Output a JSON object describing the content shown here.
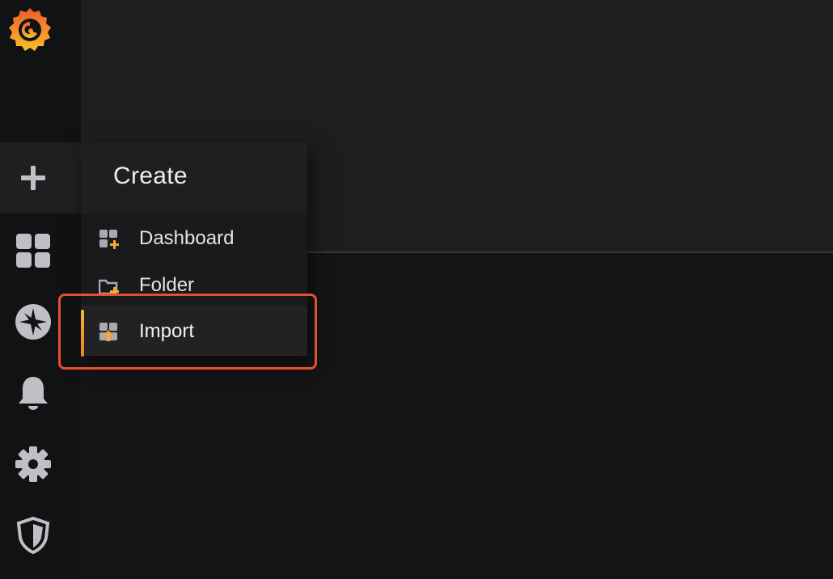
{
  "menu": {
    "title": "Create",
    "items": [
      {
        "label": "Dashboard",
        "icon": "dashboard-plus-icon"
      },
      {
        "label": "Folder",
        "icon": "folder-plus-icon"
      },
      {
        "label": "Import",
        "icon": "import-icon",
        "selected": true
      }
    ]
  },
  "sidebar": {
    "items": [
      {
        "icon": "plus-icon",
        "active": true
      },
      {
        "icon": "dashboards-grid-icon"
      },
      {
        "icon": "explore-compass-icon"
      },
      {
        "icon": "alerting-bell-icon"
      },
      {
        "icon": "configuration-gear-icon"
      },
      {
        "icon": "server-admin-shield-icon"
      }
    ]
  },
  "colors": {
    "accent": "#f6b33c",
    "highlight_border": "#e2512c",
    "logo": "#f3792a"
  }
}
